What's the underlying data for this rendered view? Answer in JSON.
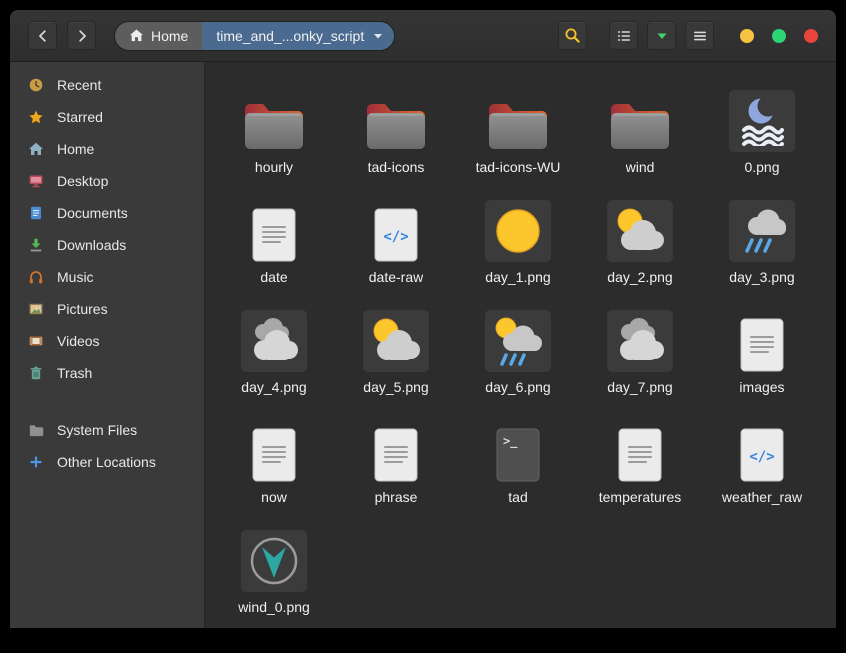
{
  "header": {
    "breadcrumb": {
      "home_label": "Home",
      "current_label": "time_and_...onky_script"
    }
  },
  "colors": {
    "breadcrumb_accent_blue": "#4a6b8f",
    "folder_red": "#a83238",
    "folder_orange": "#dd6b2a",
    "dot_yellow": "#f6c343",
    "dot_green": "#2ed373",
    "dot_red": "#e8453c",
    "search_icon_yellow": "#f3c229",
    "view_arrow_green": "#3fd36c",
    "wind_arrow_teal": "#2aa8a1"
  },
  "sidebar": {
    "items": [
      {
        "label": "Recent",
        "icon": "recent-icon"
      },
      {
        "label": "Starred",
        "icon": "starred-icon"
      },
      {
        "label": "Home",
        "icon": "home-icon"
      },
      {
        "label": "Desktop",
        "icon": "desktop-icon"
      },
      {
        "label": "Documents",
        "icon": "documents-icon"
      },
      {
        "label": "Downloads",
        "icon": "downloads-icon"
      },
      {
        "label": "Music",
        "icon": "music-icon"
      },
      {
        "label": "Pictures",
        "icon": "pictures-icon"
      },
      {
        "label": "Videos",
        "icon": "videos-icon"
      },
      {
        "label": "Trash",
        "icon": "trash-icon"
      }
    ],
    "secondary_items": [
      {
        "label": "System Files",
        "icon": "system-files-icon"
      },
      {
        "label": "Other Locations",
        "icon": "other-locations-icon"
      }
    ]
  },
  "files": [
    {
      "name": "hourly",
      "icon": "folder-icon",
      "kind": "folder"
    },
    {
      "name": "tad-icons",
      "icon": "folder-icon",
      "kind": "folder"
    },
    {
      "name": "tad-icons-WU",
      "icon": "folder-icon",
      "kind": "folder"
    },
    {
      "name": "wind",
      "icon": "folder-icon",
      "kind": "folder"
    },
    {
      "name": "0.png",
      "icon": "moon-fog-icon",
      "kind": "image"
    },
    {
      "name": "date",
      "icon": "text-file-icon",
      "kind": "text"
    },
    {
      "name": "date-raw",
      "icon": "code-file-icon",
      "kind": "code"
    },
    {
      "name": "day_1.png",
      "icon": "sun-icon",
      "kind": "image"
    },
    {
      "name": "day_2.png",
      "icon": "sun-cloud-icon",
      "kind": "image"
    },
    {
      "name": "day_3.png",
      "icon": "rain-cloud-icon",
      "kind": "image"
    },
    {
      "name": "day_4.png",
      "icon": "clouds-icon",
      "kind": "image"
    },
    {
      "name": "day_5.png",
      "icon": "sun-cloud-icon",
      "kind": "image"
    },
    {
      "name": "day_6.png",
      "icon": "sun-rain-icon",
      "kind": "image"
    },
    {
      "name": "day_7.png",
      "icon": "clouds-icon",
      "kind": "image"
    },
    {
      "name": "images",
      "icon": "text-file-icon",
      "kind": "text"
    },
    {
      "name": "now",
      "icon": "text-file-icon",
      "kind": "text"
    },
    {
      "name": "phrase",
      "icon": "text-file-icon",
      "kind": "text"
    },
    {
      "name": "tad",
      "icon": "script-file-icon",
      "kind": "script"
    },
    {
      "name": "temperatures",
      "icon": "text-file-icon",
      "kind": "text"
    },
    {
      "name": "weather_raw",
      "icon": "code-file-icon",
      "kind": "code"
    },
    {
      "name": "wind_0.png",
      "icon": "wind-compass-icon",
      "kind": "image"
    }
  ]
}
